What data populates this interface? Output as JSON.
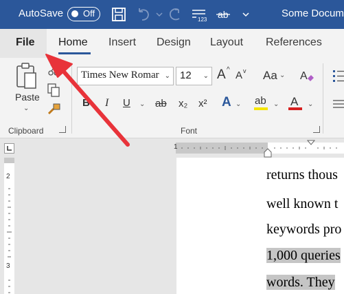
{
  "titlebar": {
    "autosave_label": "AutoSave",
    "toggle_state": "Off",
    "doc_title": "Some Docum"
  },
  "tabs": [
    {
      "label": "File"
    },
    {
      "label": "Home"
    },
    {
      "label": "Insert"
    },
    {
      "label": "Design"
    },
    {
      "label": "Layout"
    },
    {
      "label": "References"
    }
  ],
  "ribbon": {
    "clipboard": {
      "paste_label": "Paste",
      "group_label": "Clipboard"
    },
    "font": {
      "font_name": "Times New Romar",
      "font_size": "12",
      "grow_label": "A",
      "shrink_label": "A",
      "case_label": "Aa",
      "bold": "B",
      "italic": "I",
      "underline": "U",
      "strike": "ab",
      "subscript": "x₂",
      "superscript": "x²",
      "effects": "A",
      "highlight": "ab",
      "font_color": "A",
      "group_label": "Font"
    },
    "colors": {
      "highlight": "#f5e500",
      "font_color": "#d61f1f",
      "accent": "#2b579a"
    }
  },
  "vruler_numbers": [
    "2",
    "3"
  ],
  "ruler_number": "1",
  "document": {
    "lines": [
      {
        "text": "returns thous",
        "highlight": false
      },
      {
        "text": "well known t",
        "highlight": false
      },
      {
        "text": "keywords pro",
        "highlight": false
      },
      {
        "text": "1,000 queries",
        "highlight": true
      },
      {
        "text": "words. They",
        "highlight": true
      }
    ]
  }
}
